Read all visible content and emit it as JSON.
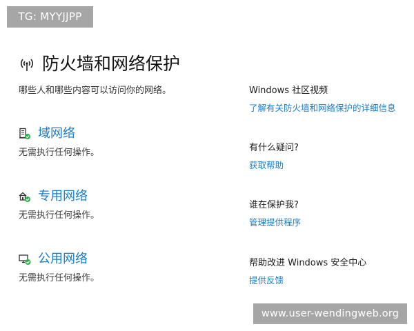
{
  "badge": "TG: MYYJJPP",
  "page": {
    "title": "防火墙和网络保护",
    "subtitle": "哪些人和哪些内容可以访问你的网络。",
    "icon": "wifi-antenna-icon"
  },
  "networks": [
    {
      "title": "域网络",
      "status": "无需执行任何操作。",
      "icon": "domain-network-icon"
    },
    {
      "title": "专用网络",
      "status": "无需执行任何操作。",
      "icon": "private-network-icon"
    },
    {
      "title": "公用网络",
      "status": "无需执行任何操作。",
      "icon": "public-network-icon"
    }
  ],
  "sidebar": [
    {
      "heading": "Windows 社区视频",
      "link": "了解有关防火墙和网络保护的详细信息"
    },
    {
      "heading": "有什么疑问?",
      "link": "获取帮助"
    },
    {
      "heading": "谁在保护我?",
      "link": "管理提供程序"
    },
    {
      "heading": "帮助改进 Windows 安全中心",
      "link": "提供反馈"
    }
  ],
  "watermark": "www.user-wendingweb.org",
  "colors": {
    "link": "#1c7cc6",
    "status_ok": "#2bb04a",
    "badge_bg": "#a6a6a6"
  }
}
